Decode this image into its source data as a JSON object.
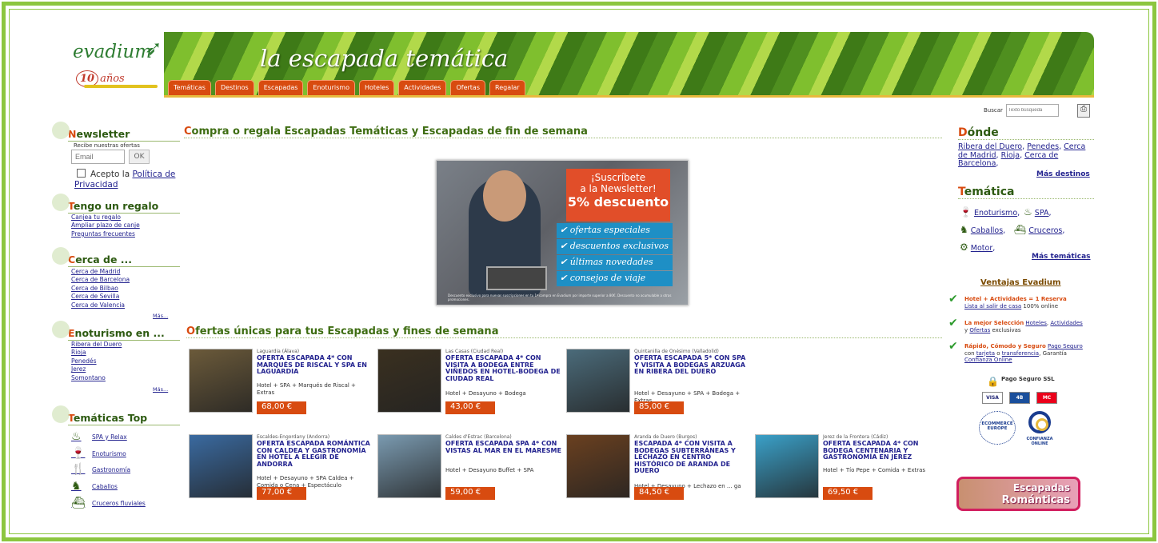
{
  "header": {
    "logo_text": "evadium",
    "logo_anniversary": "10",
    "logo_anniversary_word": "años",
    "banner_title": "la escapada temática",
    "tabs": [
      "Temáticas",
      "Destinos",
      "Escapadas",
      "Enoturismo",
      "Hoteles",
      "Actividades",
      "Ofertas",
      "Regalar"
    ],
    "search_label": "Buscar",
    "search_placeholder": "Texto búsqueda"
  },
  "left": {
    "newsletter": {
      "title_first": "N",
      "title_rest": "ewsletter",
      "subtitle": "Recibe nuestras ofertas",
      "email_placeholder": "Email",
      "ok_label": "OK",
      "accept_text": "Acepto la ",
      "policy_link": "Política de Privacidad"
    },
    "gift": {
      "title_first": "T",
      "title_rest": "engo un regalo",
      "items": [
        "Canjea tu regalo",
        "Ampliar plazo de canje",
        "Preguntas frecuentes"
      ]
    },
    "near": {
      "title_first": "C",
      "title_rest": "erca de ...",
      "items": [
        "Cerca de Madrid",
        "Cerca de Barcelona",
        "Cerca de Bilbao",
        "Cerca de Sevilla",
        "Cerca de Valencia"
      ],
      "more": "Más..."
    },
    "wine": {
      "title_first": "E",
      "title_rest": "noturismo en ...",
      "items": [
        "Ribera del Duero",
        "Rioja",
        "Penedés",
        "Jerez",
        "Somontano"
      ],
      "more": "Más..."
    },
    "topics": {
      "title_first": "T",
      "title_rest": "emáticas Top",
      "items": [
        "SPA y Relax",
        "Enoturismo",
        "Gastronomía",
        "Caballos",
        "Cruceros fluviales"
      ]
    }
  },
  "main": {
    "heading1_first": "C",
    "heading1_rest": "ompra o regala Escapadas Temáticas y Escapadas de fin de semana",
    "promo": {
      "line1": "¡Suscríbete",
      "line2": "a la Newsletter!",
      "line3": "5% descuento",
      "checks": [
        "ofertas especiales",
        "descuentos exclusivos",
        "últimas novedades",
        "consejos de viaje"
      ],
      "fine": "Descuento exclusivo para nuevas suscripciones en tu 1ª compra en Evadium por importe superior a 80€. Descuento no acumulable a otras promociones."
    },
    "heading2_first": "O",
    "heading2_rest": "fertas únicas para tus Escapadas y fines de semana",
    "offers": [
      {
        "loc": "Laguardia (Álava)",
        "title": "Oferta Escapada 4* con Marqués de Riscal y SPA en Laguardia",
        "desc": "Hotel + SPA + Marqués de Riscal + Extras",
        "price": "68,00 €",
        "img": "#6b5a3a"
      },
      {
        "loc": "Las Casas (Ciudad Real)",
        "title": "Oferta Escapada 4* con visita a bodega entre viñedos en hotel-bodega de Ciudad Real",
        "desc": "Hotel + Desayuno + Bodega",
        "price": "43,00 €",
        "img": "#3a3020"
      },
      {
        "loc": "Quintanilla de Onésimo (Valladolid)",
        "title": "Oferta Escapada 5* con SPA y visita a Bodegas Arzuaga en Ribera del Duero",
        "desc": "Hotel + Desayuno + SPA + Bodega + Extras",
        "price": "85,00 €",
        "img": "#4b6b7a"
      },
      {
        "loc": "Escaldes-Engordany (Andorra)",
        "title": "Oferta Escapada romántica con Caldea y gastronomía en hotel a elegir de Andorra",
        "desc": "Hotel + Desayuno + SPA Caldea + Comida o Cena + Espectáculo",
        "price": "77,00 €",
        "img": "#3a6aa0"
      },
      {
        "loc": "Caldes d'Estrac (Barcelona)",
        "title": "Oferta Escapada SPA 4* con vistas al mar en el Maresme",
        "desc": "Hotel + Desayuno Buffet + SPA",
        "price": "59,00 €",
        "img": "#7a9ab0"
      },
      {
        "loc": "Aranda de Duero (Burgos)",
        "title": "Escapada 4* con visita a bodegas subterráneas y lechazo en centro histórico de Aranda de Duero",
        "desc": "Hotel + Desayuno + Lechazo en ... ga subterránea",
        "price": "84,50 €",
        "img": "#6a4020"
      },
      {
        "loc": "Jerez de la Frontera (Cádiz)",
        "title": "Oferta Escapada 4* con bodega centenaria y gastronomía en Jerez",
        "desc": "Hotel + Tío Pepe + Comida + Extras",
        "price": "69,50 €",
        "img": "#3aa0c8"
      }
    ]
  },
  "right": {
    "donde": {
      "title_first": "D",
      "title_rest": "ónde",
      "links": [
        "Ribera del Duero",
        "Penedes",
        "Cerca de Madrid",
        "Rioja",
        "Cerca de Barcelona"
      ],
      "more": "Más destinos"
    },
    "tematica": {
      "title_first": "T",
      "title_rest": "emática",
      "items": [
        "Enoturismo",
        "SPA",
        "Caballos",
        "Cruceros",
        "Motor"
      ],
      "more": "Más temáticas"
    },
    "ventajas": {
      "title": "Ventajas Evadium",
      "row1_hl": "Hotel + Actividades = 1 Reserva",
      "row1_link": "Lista al salir de casa",
      "row1_rest": " 100% online",
      "row2_hl": "La mejor Selección",
      "row2_links": [
        "Hoteles",
        "Actividades",
        "Ofertas"
      ],
      "row2_rest": "exclusivas",
      "row3_hl": "Rápido, Cómodo y Seguro",
      "row3_link1": "Pago Seguro",
      "row3_mid": "con",
      "row3_link2": "tarjeta",
      "row3_or": "o",
      "row3_link3": "transferencia",
      "row3_guar": "Garantía",
      "row3_link4": "Confianza Online"
    },
    "ssl": "Pago Seguro SSL",
    "cards": [
      "VISA",
      "4B",
      "MC"
    ],
    "ecommerce": "ECOMMERCE EUROPE",
    "confianza": "CONFIANZA ONLINE",
    "romantic_line1": "Escapadas",
    "romantic_line2": "Románticas"
  }
}
